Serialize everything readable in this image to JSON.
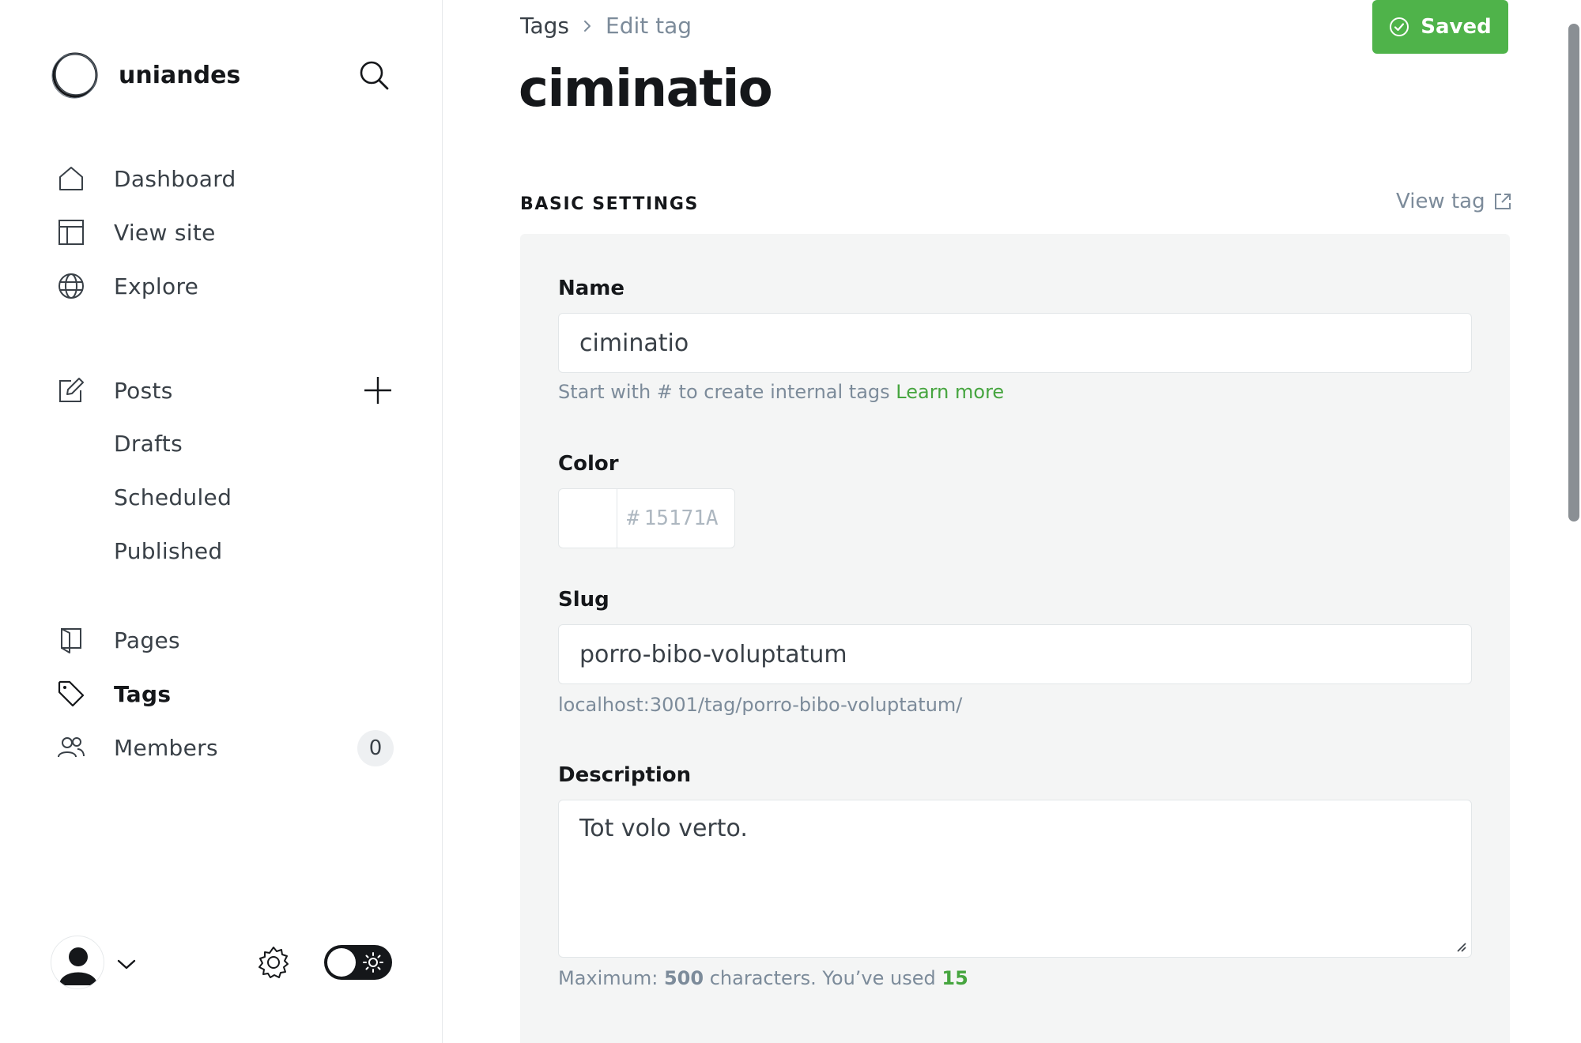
{
  "sidebar": {
    "brand_name": "uniandes",
    "nav": {
      "dashboard": "Dashboard",
      "view_site": "View site",
      "explore": "Explore",
      "posts": "Posts",
      "drafts": "Drafts",
      "scheduled": "Scheduled",
      "published": "Published",
      "pages": "Pages",
      "tags": "Tags",
      "members": "Members",
      "members_count": "0"
    },
    "active_item": "tags"
  },
  "header": {
    "breadcrumb_root": "Tags",
    "breadcrumb_current": "Edit tag",
    "title": "ciminatio",
    "save_status": "Saved"
  },
  "section": {
    "heading": "BASIC SETTINGS",
    "view_tag": "View tag"
  },
  "form": {
    "name": {
      "label": "Name",
      "value": "ciminatio",
      "hint": "Start with # to create internal tags",
      "hint_link": "Learn more"
    },
    "color": {
      "label": "Color",
      "hash": "#",
      "placeholder": "15171A"
    },
    "slug": {
      "label": "Slug",
      "value": "porro-bibo-voluptatum",
      "url": "localhost:3001/tag/porro-bibo-voluptatum/"
    },
    "description": {
      "label": "Description",
      "value": "Tot volo verto.",
      "counter_prefix": "Maximum:",
      "max": "500",
      "counter_middle": "characters. You’ve used",
      "used": "15"
    }
  },
  "colors": {
    "accent_green": "#4fb34a",
    "link_green": "#46a53f",
    "panel_bg": "#f4f5f5",
    "text_dark": "#15171a",
    "text_muted": "#7c8b9a"
  }
}
